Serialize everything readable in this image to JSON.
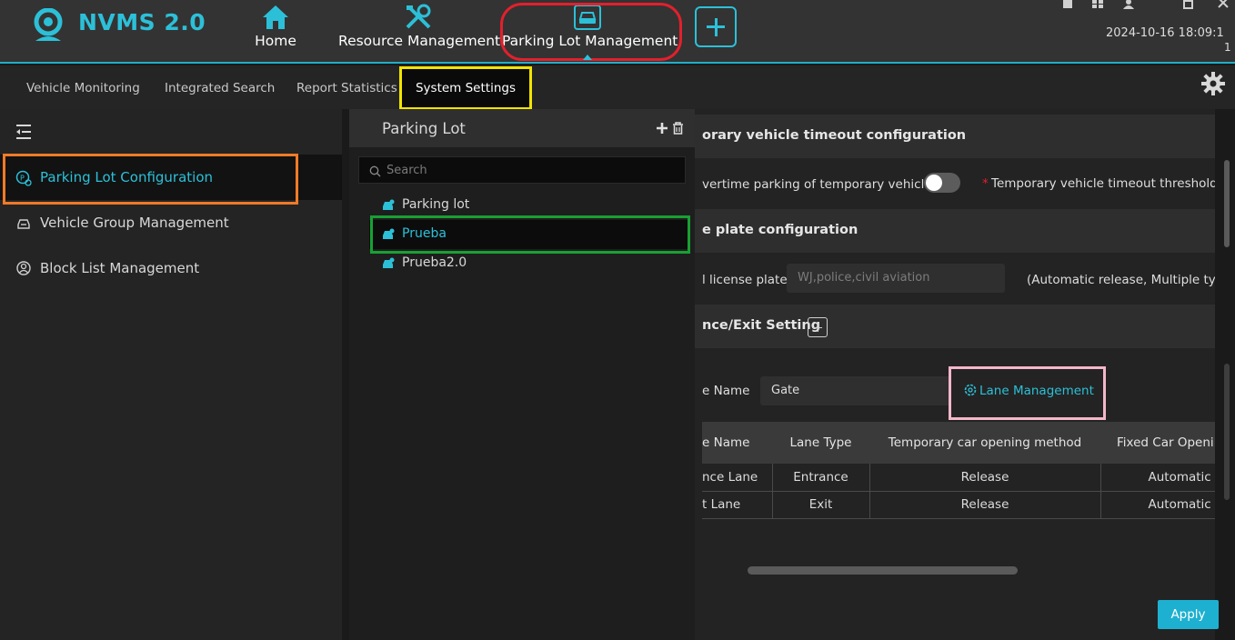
{
  "app": {
    "title": "NVMS 2.0"
  },
  "topnav": {
    "items": [
      {
        "label": "Home",
        "icon": "home-icon"
      },
      {
        "label": "Resource Management",
        "icon": "tools-icon"
      },
      {
        "label": "Parking Lot Management",
        "icon": "car-icon"
      }
    ],
    "add_icon": "plus-icon",
    "datetime": "2024-10-16 18:09:1",
    "datetime_line2": "1"
  },
  "subtabs": {
    "items": [
      "Vehicle Monitoring",
      "Integrated Search",
      "Report Statistics",
      "System Settings"
    ],
    "active": "System Settings"
  },
  "sidebar": {
    "items": [
      {
        "label": "Parking Lot Configuration",
        "icon": "parking-config-icon"
      },
      {
        "label": "Vehicle Group Management",
        "icon": "vehicle-group-icon"
      },
      {
        "label": "Block List Management",
        "icon": "block-list-icon"
      }
    ],
    "active": "Parking Lot Configuration"
  },
  "parking_lot_panel": {
    "title": "Parking Lot",
    "search_placeholder": "Search",
    "items": [
      "Parking lot",
      "Prueba",
      "Prueba2.0"
    ],
    "selected": "Prueba"
  },
  "config": {
    "section1_title": "orary vehicle timeout configuration",
    "overtime_label": "vertime parking of temporary vehicles",
    "overtime_enabled": false,
    "required_mark": "*",
    "threshold_label": "Temporary vehicle timeout threshold (ho",
    "section2_title": "e plate configuration",
    "special_plate_label": "l license plate",
    "special_plate_placeholder": "WJ,police,civil aviation",
    "special_plate_note": "(Automatic release, Multiple types",
    "section3_title": "nce/Exit Setting",
    "entrance_name_label": "e Name",
    "entrance_name_value": "Gate",
    "lane_management_label": "Lane Management",
    "table": {
      "headers": [
        "e Name",
        "Lane Type",
        "Temporary car opening method",
        "Fixed Car Openi"
      ],
      "rows": [
        [
          "nce Lane",
          "Entrance",
          "Release",
          "Automatic R"
        ],
        [
          "t Lane",
          "Exit",
          "Release",
          "Automatic R"
        ]
      ]
    },
    "apply_label": "Apply"
  },
  "colors": {
    "accent": "#2cc0d8",
    "topbar": "#333333",
    "highlight_red": "#e2202c",
    "highlight_yellow": "#f2e400",
    "highlight_orange": "#f07a27",
    "highlight_green": "#18a033",
    "highlight_pink": "#f3b7c9"
  }
}
